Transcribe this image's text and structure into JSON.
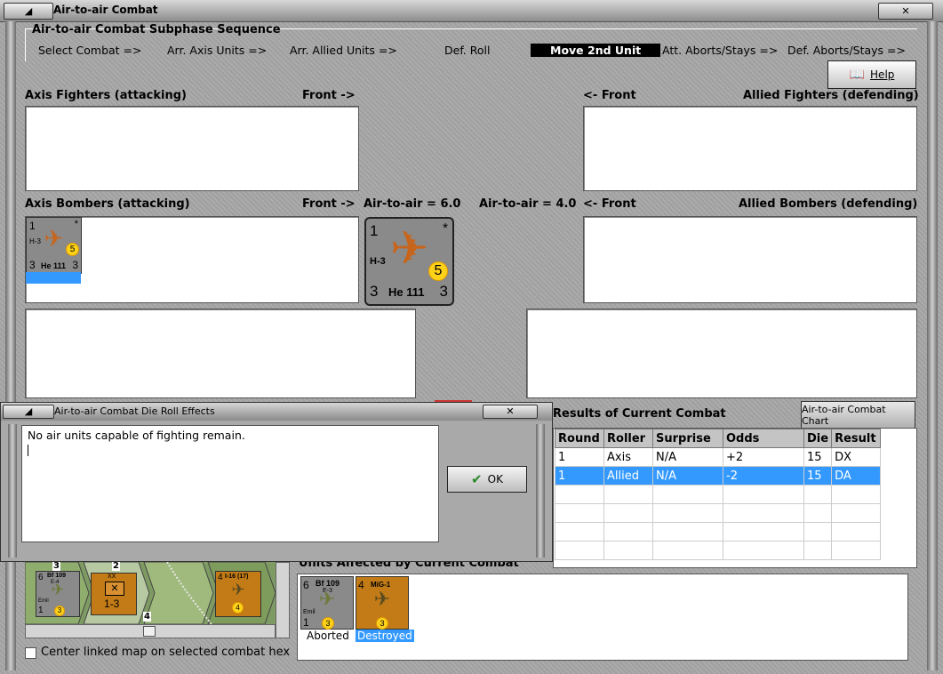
{
  "window": {
    "title": "Air-to-air Combat"
  },
  "sequence": {
    "title": "Air-to-air Combat Subphase Sequence",
    "items": [
      "Select Combat =>",
      "Arr. Axis Units =>",
      "Arr. Allied Units =>",
      "Def. Roll",
      "Move 2nd Unit",
      "Att. Aborts/Stays =>",
      "Def. Aborts/Stays =>"
    ],
    "active_index": 4
  },
  "help": {
    "label": "Help"
  },
  "sections": {
    "axis_fighters": "Axis Fighters (attacking)",
    "axis_front": "Front ->",
    "allied_front": "<- Front",
    "allied_fighters": "Allied Fighters (defending)",
    "axis_bombers": "Axis Bombers (attacking)",
    "axis_bombers_front": "Front ->",
    "axis_air": "Air-to-air = 6.0",
    "allied_air": "Air-to-air = 4.0",
    "allied_bombers_front": "<- Front",
    "allied_bombers": "Allied Bombers (defending)"
  },
  "axis_bomber_unit": {
    "small": {
      "top_left": "1",
      "star": "*",
      "code": "H-3",
      "name": "He 111",
      "bottom_left": "3",
      "bottom_right": "3",
      "dot": "5"
    },
    "large": {
      "top_left": "1",
      "star": "*",
      "code": "H-3",
      "name": "He 111",
      "bottom_left": "3",
      "bottom_right": "3",
      "dot": "5"
    }
  },
  "dialog": {
    "title": "Air-to-air Combat Die Roll Effects",
    "message": "No air units capable of fighting remain.",
    "ok": "OK"
  },
  "results": {
    "title": "Results of Current Combat",
    "chart_button": "Air-to-air Combat Chart",
    "columns": [
      "Round",
      "Roller",
      "Surprise",
      "Odds",
      "Die",
      "Result"
    ],
    "rows": [
      [
        "1",
        "Axis",
        "N/A",
        "+2",
        "15",
        "DX"
      ],
      [
        "1",
        "Allied",
        "N/A",
        "-2",
        "15",
        "DA"
      ]
    ],
    "selected_row": 1
  },
  "map": {
    "hex_numbers": [
      "3",
      "2",
      "4"
    ],
    "counters": [
      {
        "top": "6",
        "name": "Bf 109",
        "code": "E-4",
        "sub": "Emil",
        "bl": "1",
        "dot": "3"
      },
      {
        "top": "XX",
        "value": "1-3"
      },
      {
        "top": "4",
        "name": "I-16 (17)",
        "dot": "4"
      }
    ]
  },
  "units_affected": {
    "title": "Units Affected by Current Combat",
    "units": [
      {
        "top": "6",
        "name": "Bf 109",
        "code": "E-3",
        "sub": "Emil",
        "bl": "1",
        "dot": "3",
        "status": "Aborted"
      },
      {
        "top": "4",
        "name": "MiG-1",
        "dot": "3",
        "status": "Destroyed"
      }
    ]
  },
  "center_map": {
    "label": "Center linked map on selected combat hex"
  },
  "colors": {
    "selection": "#3399ff",
    "plane": "#c8651c",
    "dot": "#ffd21a"
  }
}
